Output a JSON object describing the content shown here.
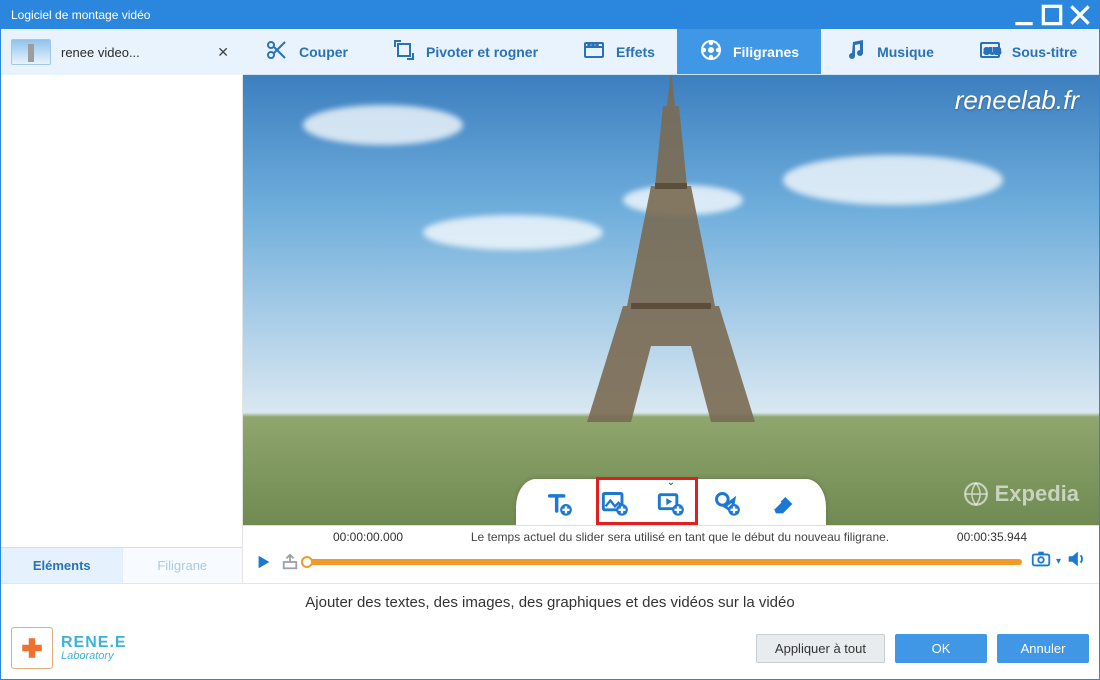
{
  "window_title": "Logiciel de montage vidéo",
  "file_tab": {
    "label": "renee video..."
  },
  "toolbar": [
    {
      "id": "cut",
      "label": "Couper",
      "active": false
    },
    {
      "id": "rotate",
      "label": "Pivoter et rogner",
      "active": false
    },
    {
      "id": "effects",
      "label": "Effets",
      "active": false
    },
    {
      "id": "watermark",
      "label": "Filigranes",
      "active": true
    },
    {
      "id": "music",
      "label": "Musique",
      "active": false
    },
    {
      "id": "subtitle",
      "label": "Sous-titre",
      "active": false
    }
  ],
  "sidebar_tabs": {
    "elements": "Eléments",
    "watermark": "Filigrane",
    "active": "elements"
  },
  "preview": {
    "site_watermark": "reneelab.fr",
    "vendor_watermark": "Expedia"
  },
  "timeline": {
    "start": "00:00:00.000",
    "end": "00:00:35.944",
    "hint": "Le temps actuel du slider sera utilisé en tant que le début du nouveau filigrane."
  },
  "footer": {
    "message": "Ajouter des textes, des images, des graphiques et des vidéos sur la vidéo",
    "brand_name": "RENE.E",
    "brand_sub": "Laboratory",
    "apply_all": "Appliquer à tout",
    "ok": "OK",
    "cancel": "Annuler"
  },
  "action_buttons": [
    "add-text",
    "add-image",
    "add-video",
    "add-shape",
    "erase"
  ]
}
